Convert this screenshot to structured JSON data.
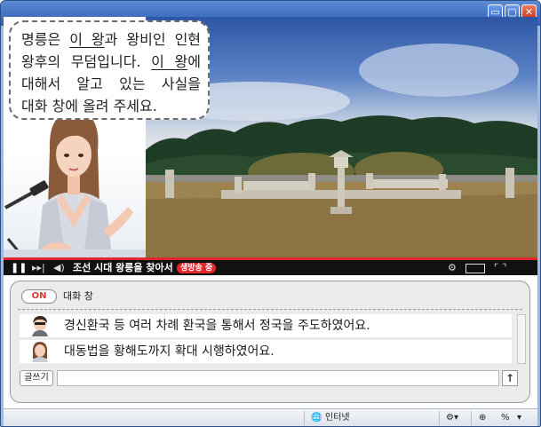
{
  "window": {
    "buttons": {
      "minimize": "▭",
      "maximize": "▢",
      "close": "✕"
    }
  },
  "bubble": {
    "line1_pre": "명릉은 ",
    "line1_ul": "이 왕",
    "line1_post": "과 왕비인 인현",
    "line2_pre": "왕후의 무덤입니다. ",
    "line2_ul": "이 왕",
    "line2_post": "에",
    "line3": "대해서 알고 있는 사실을",
    "line4": "대화 창에 올려 주세요."
  },
  "player": {
    "title": "조선 시대 왕릉을 찾아서",
    "live_badge": "생방송 중"
  },
  "chat": {
    "toggle": "ON",
    "title": "대화 창",
    "messages": [
      {
        "avatar": "boy-avatar-icon",
        "text": "경신환국 등 여러 차례 환국을 통해서 정국을 주도하였어요."
      },
      {
        "avatar": "girl-avatar-icon",
        "text": "대동법을 황해도까지 확대 시행하였어요."
      }
    ],
    "write_label": "글쓰기",
    "input_value": "",
    "send_label": "↑"
  },
  "statusbar": {
    "zone": "인터넷",
    "zoom_symbol": "%"
  },
  "colors": {
    "accent_red": "#e0282e",
    "titlebar": "#3a6ec6"
  }
}
